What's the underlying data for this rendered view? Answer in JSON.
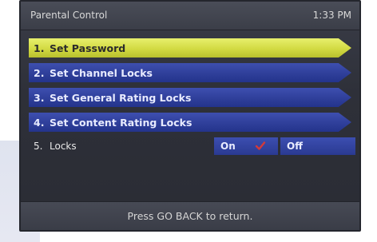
{
  "screen": {
    "title": "Parental Control",
    "clock": "1:33 PM"
  },
  "menu": {
    "items": [
      {
        "num": "1.",
        "label": "Set Password"
      },
      {
        "num": "2.",
        "label": "Set Channel Locks"
      },
      {
        "num": "3.",
        "label": "Set General Rating Locks"
      },
      {
        "num": "4.",
        "label": "Set Content Rating Locks"
      }
    ],
    "locks": {
      "num": "5.",
      "label": "Locks",
      "on_label": "On",
      "off_label": "Off",
      "selected": "On"
    }
  },
  "footer": {
    "hint": "Press GO BACK to return."
  },
  "colors": {
    "active_item": "#d2da42",
    "normal_item": "#2f3f9a",
    "frame": "#2e3039",
    "check_mark": "#d23a3a"
  },
  "icons": {
    "selected_indicator": "check-icon"
  }
}
